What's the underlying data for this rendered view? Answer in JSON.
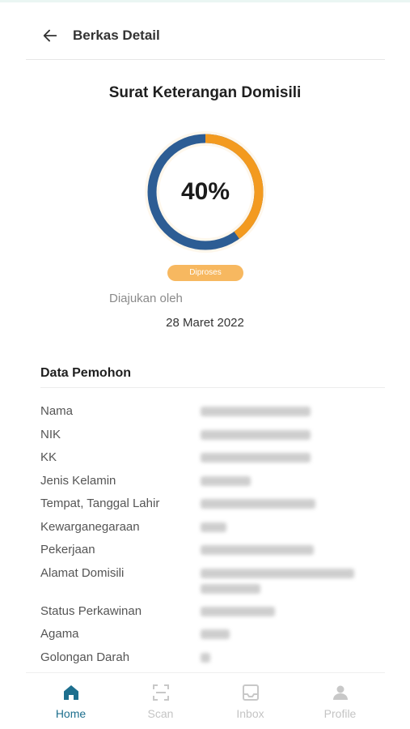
{
  "header": {
    "title": "Berkas Detail"
  },
  "document": {
    "title": "Surat Keterangan Domisili",
    "progress_percent": 40,
    "progress_label": "40%",
    "status": "Diproses",
    "submitted_by_label": "Diajukan oleh",
    "submitted_date": "28 Maret 2022"
  },
  "colors": {
    "ring_done": "#2d5d94",
    "ring_progress": "#f39a1f",
    "status_pill": "#f7b860",
    "nav_active": "#1d6f8e"
  },
  "applicant": {
    "title": "Data Pemohon",
    "fields": [
      {
        "label": "Nama"
      },
      {
        "label": "NIK"
      },
      {
        "label": "KK"
      },
      {
        "label": "Jenis Kelamin"
      },
      {
        "label": "Tempat, Tanggal Lahir"
      },
      {
        "label": "Kewarganegaraan"
      },
      {
        "label": "Pekerjaan"
      },
      {
        "label": "Alamat Domisili"
      },
      {
        "label": "Status Perkawinan"
      },
      {
        "label": "Agama"
      },
      {
        "label": "Golongan Darah"
      }
    ]
  },
  "nav": {
    "items": [
      {
        "label": "Home",
        "icon": "home-icon",
        "active": true
      },
      {
        "label": "Scan",
        "icon": "scan-icon",
        "active": false
      },
      {
        "label": "Inbox",
        "icon": "inbox-icon",
        "active": false
      },
      {
        "label": "Profile",
        "icon": "profile-icon",
        "active": false
      }
    ]
  }
}
